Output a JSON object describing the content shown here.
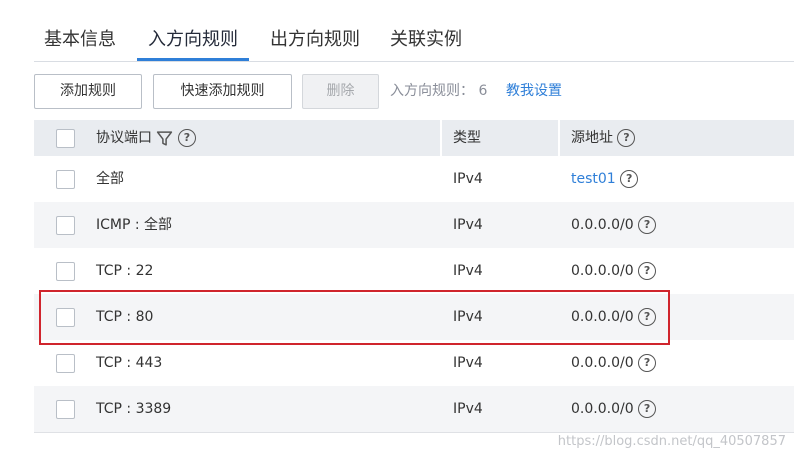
{
  "tabs": [
    {
      "label": "基本信息"
    },
    {
      "label": "入方向规则"
    },
    {
      "label": "出方向规则"
    },
    {
      "label": "关联实例"
    }
  ],
  "toolbar": {
    "add_label": "添加规则",
    "quick_add_label": "快速添加规则",
    "delete_label": "删除",
    "rule_count_text": "入方向规则： 6",
    "help_link": "教我设置"
  },
  "table": {
    "headers": {
      "protocol": "协议端口",
      "type": "类型",
      "source": "源地址"
    },
    "rows": [
      {
        "protocol": "全部",
        "type": "IPv4",
        "source": "test01"
      },
      {
        "protocol": "ICMP : 全部",
        "type": "IPv4",
        "source": "0.0.0.0/0"
      },
      {
        "protocol": "TCP : 22",
        "type": "IPv4",
        "source": "0.0.0.0/0"
      },
      {
        "protocol": "TCP : 80",
        "type": "IPv4",
        "source": "0.0.0.0/0"
      },
      {
        "protocol": "TCP : 443",
        "type": "IPv4",
        "source": "0.0.0.0/0"
      },
      {
        "protocol": "TCP : 3389",
        "type": "IPv4",
        "source": "0.0.0.0/0"
      }
    ]
  },
  "icons": {
    "help": "?"
  },
  "watermark": "https://blog.csdn.net/qq_40507857",
  "colors": {
    "accent": "#2f7fd8",
    "highlight": "#d0252d",
    "header_bg": "#e9ecf0",
    "alt_row_bg": "#f4f5f7"
  }
}
